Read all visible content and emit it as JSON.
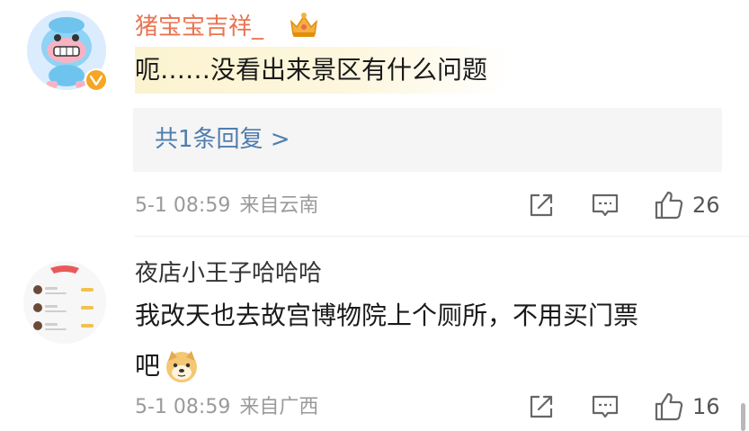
{
  "comments": [
    {
      "username": "猪宝宝吉祥_",
      "text": "呃……没看出来景区有什么问题",
      "replies_label": "共1条回复 >",
      "time": "5-1 08:59",
      "location": "来自云南",
      "likes": "26"
    },
    {
      "username": "夜店小王子哈哈哈",
      "text_line1": "我改天也去故宫博物院上个厕所，不用买门票",
      "text_line2": "吧",
      "time": "5-1 08:59",
      "location": "来自广西",
      "likes": "16"
    }
  ],
  "icons": {
    "share": "share-icon",
    "comment": "comment-icon",
    "like": "thumbs-up-icon",
    "verified": "verified-badge-icon",
    "crown": "crown-icon",
    "emoji": "doge-emoji"
  },
  "colors": {
    "username_vip": "#eb7350",
    "link": "#507daf",
    "meta": "#9a9a9a"
  }
}
